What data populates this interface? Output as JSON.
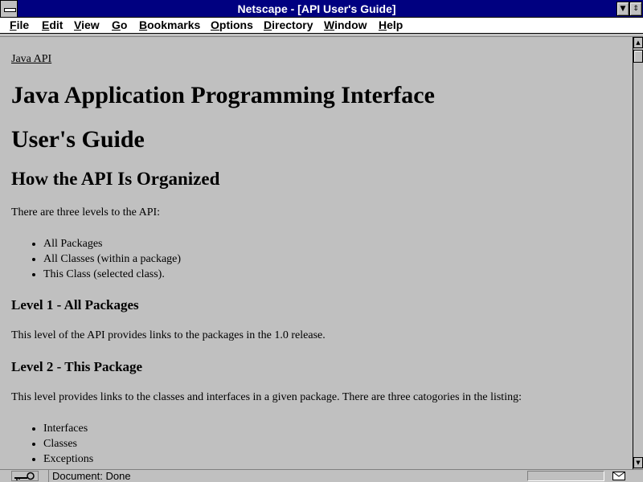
{
  "window": {
    "title": "Netscape - [API User's Guide]"
  },
  "menu": [
    {
      "u": "F",
      "rest": "ile"
    },
    {
      "u": "E",
      "rest": "dit"
    },
    {
      "u": "V",
      "rest": "iew"
    },
    {
      "u": "G",
      "rest": "o"
    },
    {
      "u": "B",
      "rest": "ookmarks"
    },
    {
      "u": "O",
      "rest": "ptions"
    },
    {
      "u": "D",
      "rest": "irectory"
    },
    {
      "u": "W",
      "rest": "indow"
    },
    {
      "u": "H",
      "rest": "elp"
    }
  ],
  "page": {
    "breadcrumb": "Java API",
    "title_line1": "Java Application Programming Interface",
    "title_line2": "User's Guide",
    "section_heading": "How the API Is Organized",
    "intro": "There are three levels to the API:",
    "levels": [
      "All Packages",
      "All Classes (within a package)",
      "This Class (selected class)."
    ],
    "level1_heading": "Level 1 - All Packages",
    "level1_text": "This level of the API provides links to the packages in the 1.0 release.",
    "level2_heading": "Level 2 - This Package",
    "level2_text": "This level provides links to the classes and interfaces in a given package. There are three catogories in the listing:",
    "categories": [
      "Interfaces",
      "Classes",
      "Exceptions"
    ]
  },
  "status": {
    "text": "Document: Done"
  }
}
